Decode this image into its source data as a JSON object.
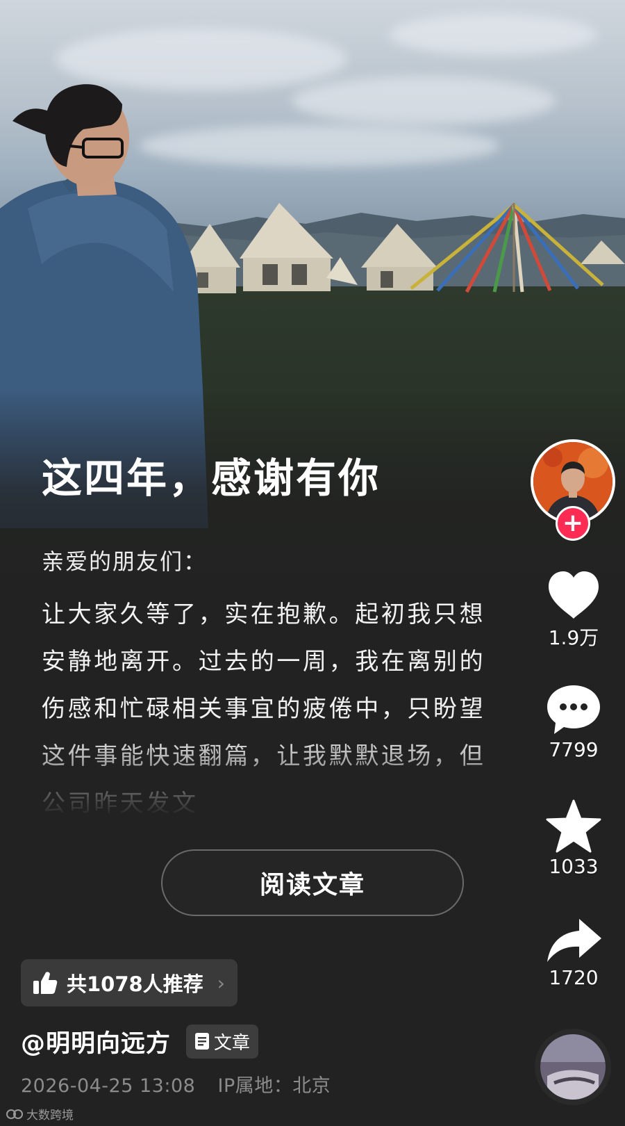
{
  "article": {
    "title": "这四年，感谢有你",
    "greeting": "亲爱的朋友们：",
    "body": "让大家久等了，实在抱歉。起初我只想安静地离开。过去的一周，我在离别的伤感和忙碌相关事宜的疲倦中，只盼望这件事能快速翻篇，让我默默退场，但公司昨天发文"
  },
  "read_button": {
    "label": "阅读文章"
  },
  "recommend": {
    "label": "共1078人推荐",
    "icon": "thumbs-up-icon"
  },
  "author": {
    "handle": "@明明向远方",
    "tag_label": "文章",
    "tag_icon": "document-icon"
  },
  "meta": {
    "datetime": "2026-04-25 13:08",
    "ip_location": "IP属地：北京"
  },
  "actions": {
    "like_count": "1.9万",
    "comment_count": "7799",
    "favorite_count": "1033",
    "share_count": "1720"
  },
  "watermark": {
    "text": "大数跨境"
  },
  "colors": {
    "accent": "#fe2c55",
    "background": "#222222",
    "text": "#ffffff",
    "muted": "#8c8c8c"
  }
}
